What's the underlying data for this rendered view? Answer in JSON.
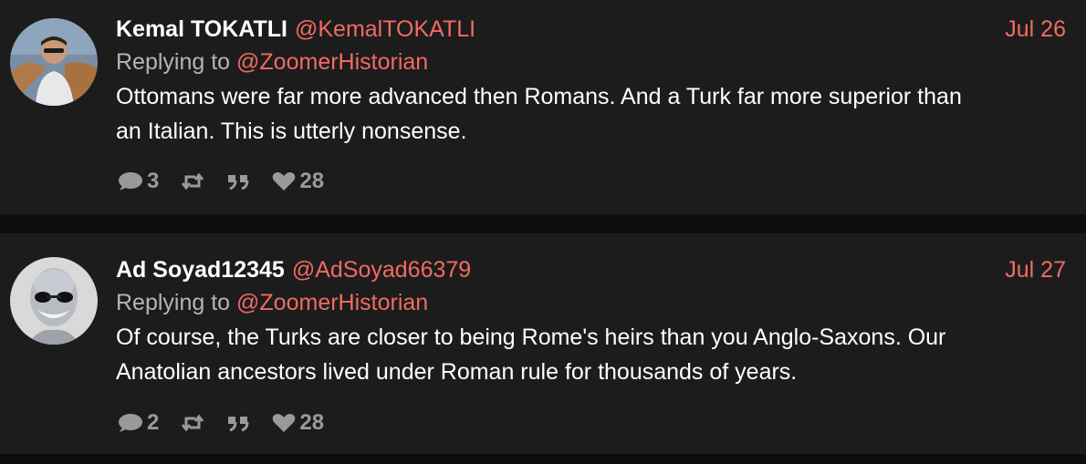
{
  "tweets": [
    {
      "name": "Kemal TOKATLI",
      "handle": "@KemalTOKATLI",
      "date": "Jul 26",
      "replying_label": "Replying to",
      "replying_handle": "@ZoomerHistorian",
      "text_lines": [
        "Ottomans were far more advanced then Romans. And a Turk far more superior than",
        "an Italian. This is utterly nonsense."
      ],
      "reply_count": "3",
      "like_count": "28",
      "icons": [
        "reply-icon",
        "retweet-icon",
        "quote-icon",
        "heart-icon"
      ]
    },
    {
      "name": "Ad Soyad12345",
      "handle": "@AdSoyad66379",
      "date": "Jul 27",
      "replying_label": "Replying to",
      "replying_handle": "@ZoomerHistorian",
      "text_lines": [
        "Of course, the Turks are closer to being Rome's heirs than you Anglo-Saxons. Our",
        "Anatolian ancestors lived under Roman rule for thousands of years."
      ],
      "reply_count": "2",
      "like_count": "28",
      "icons": [
        "reply-icon",
        "retweet-icon",
        "quote-icon",
        "heart-icon"
      ]
    }
  ],
  "colors": {
    "background": "#0d0d0d",
    "card": "#1c1c1d",
    "accent": "#f26b61",
    "muted": "#b5b5b5",
    "icon": "#9a9a9a"
  }
}
